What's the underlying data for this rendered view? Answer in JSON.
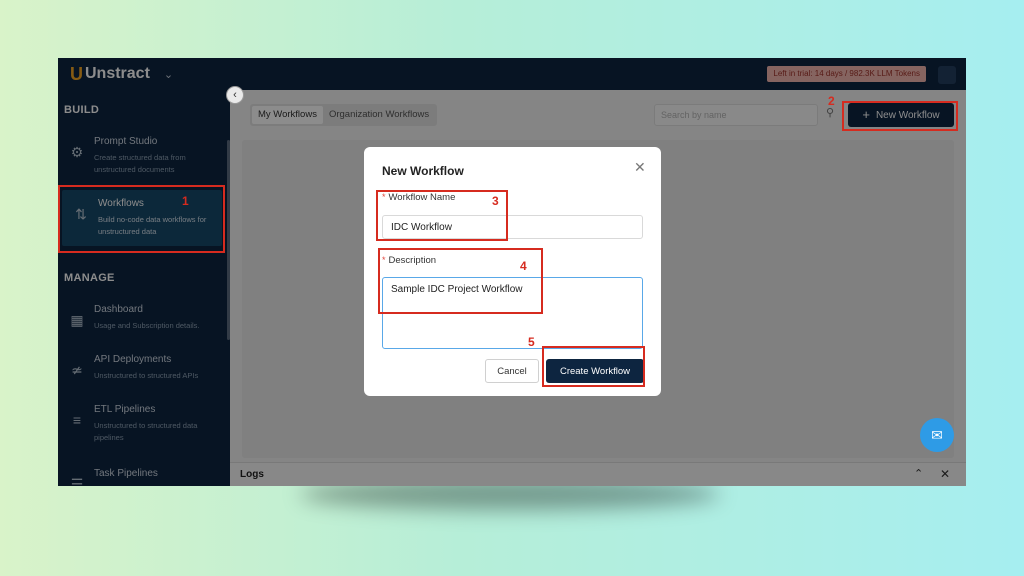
{
  "app": {
    "logo_text": "Unstract",
    "trial_text": "Left in trial: 14 days / 982.3K LLM Tokens",
    "icons": {
      "logo": "unstract-logo-icon",
      "org_switch": "chevron-down-icon",
      "collapse": "chevron-left-icon"
    }
  },
  "sidebar": {
    "sections": [
      {
        "title": "BUILD"
      },
      {
        "title": "MANAGE"
      }
    ],
    "items": [
      {
        "title": "Prompt Studio",
        "desc": "Create structured data from unstructured documents",
        "icon": "prompt-studio-icon"
      },
      {
        "title": "Workflows",
        "desc": "Build no-code data workflows for unstructured data",
        "icon": "workflow-icon",
        "active": true
      },
      {
        "title": "Dashboard",
        "desc": "Usage and Subscription details.",
        "icon": "dashboard-icon"
      },
      {
        "title": "API Deployments",
        "desc": "Unstructured to structured APIs",
        "icon": "api-icon"
      },
      {
        "title": "ETL Pipelines",
        "desc": "Unstructured to structured data pipelines",
        "icon": "etl-icon"
      },
      {
        "title": "Task Pipelines",
        "desc": "",
        "icon": "task-icon"
      }
    ]
  },
  "content": {
    "tabs": [
      "My Workflows",
      "Organization Workflows"
    ],
    "active_tab": "My Workflows",
    "search": {
      "placeholder": "Search by name",
      "value": ""
    },
    "new_workflow_label": "New Workflow"
  },
  "logs": {
    "title": "Logs"
  },
  "modal": {
    "title": "New Workflow",
    "required_mark": "*",
    "fields": {
      "name_label": "Workflow Name",
      "name_value": "IDC Workflow",
      "desc_label": "Description",
      "desc_value": "Sample IDC Project Workflow"
    },
    "cancel_label": "Cancel",
    "create_label": "Create Workflow"
  },
  "annotations": [
    "1",
    "2",
    "3",
    "4",
    "5"
  ],
  "colors": {
    "navy": "#0d2540",
    "highlight": "#d62b1f",
    "accent_blue": "#2e9be6",
    "trial_bg": "#f2b7b0"
  }
}
